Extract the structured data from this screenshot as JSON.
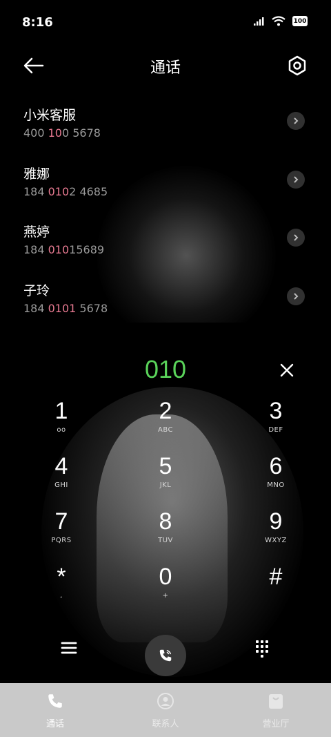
{
  "status_bar": {
    "time": "8:16",
    "battery": "100"
  },
  "header": {
    "title": "通话"
  },
  "contacts": [
    {
      "name": "小米客服",
      "num_pre": "400 ",
      "num_hl": "10",
      "num_post": "0 5678"
    },
    {
      "name": "雅娜",
      "num_pre": "184 ",
      "num_hl": "010",
      "num_post": "2 4685"
    },
    {
      "name": "燕婷",
      "num_pre": "184 ",
      "num_hl": "010",
      "num_post": "15689"
    },
    {
      "name": "子玲",
      "num_pre": "184 ",
      "num_hl": "0101",
      "num_post": " 5678"
    }
  ],
  "dialed": {
    "digits": "010",
    "color": "#5ad35a"
  },
  "keypad": [
    [
      {
        "digit": "1",
        "letters": "ᴏᴏ"
      },
      {
        "digit": "2",
        "letters": "ABC"
      },
      {
        "digit": "3",
        "letters": "DEF"
      }
    ],
    [
      {
        "digit": "4",
        "letters": "GHI"
      },
      {
        "digit": "5",
        "letters": "JKL"
      },
      {
        "digit": "6",
        "letters": "MNO"
      }
    ],
    [
      {
        "digit": "7",
        "letters": "PQRS"
      },
      {
        "digit": "8",
        "letters": "TUV"
      },
      {
        "digit": "9",
        "letters": "WXYZ"
      }
    ],
    [
      {
        "digit": "*",
        "letters": ","
      },
      {
        "digit": "0",
        "letters": "+"
      },
      {
        "digit": "#",
        "letters": ""
      }
    ]
  ],
  "bottom_nav": [
    {
      "label": "通话",
      "icon": "phone-icon",
      "active": true
    },
    {
      "label": "联系人",
      "icon": "contacts-icon",
      "active": false
    },
    {
      "label": "营业厅",
      "icon": "store-icon",
      "active": false
    }
  ],
  "colors": {
    "accent_green": "#5ad35a",
    "highlight_pink": "#e87a91"
  }
}
